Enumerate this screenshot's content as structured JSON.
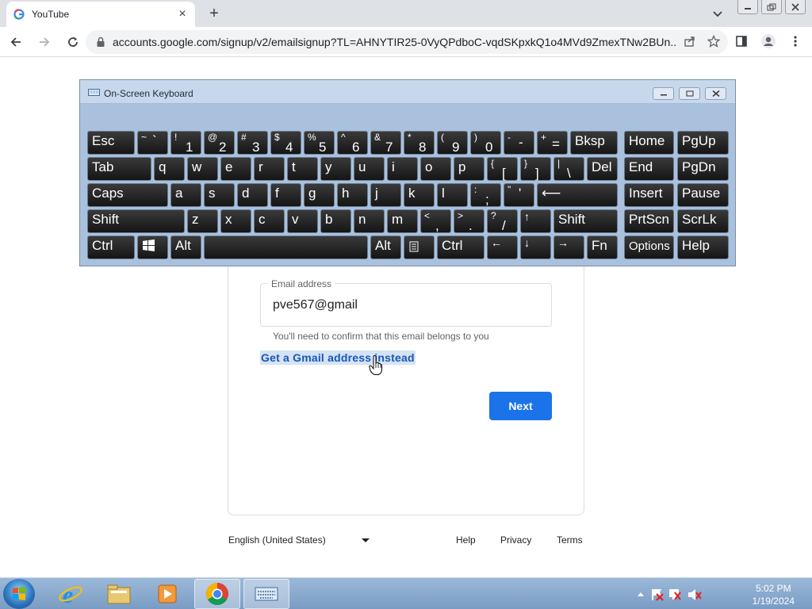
{
  "browser": {
    "tab_title": "YouTube",
    "url": "accounts.google.com/signup/v2/emailsignup?TL=AHNYTIR25-0VyQPdboC-vqdSKpxkQ1o4MVd9ZmexTNw2BUn..."
  },
  "form": {
    "email_label": "Email address",
    "email_value": "pve567@gmail",
    "helper": "You'll need to confirm that this email belongs to you",
    "gmail_link": "Get a Gmail address instead",
    "next": "Next"
  },
  "footer": {
    "language": "English (United States)",
    "help": "Help",
    "privacy": "Privacy",
    "terms": "Terms"
  },
  "osk": {
    "title": "On-Screen Keyboard",
    "keys": {
      "esc": "Esc",
      "tilde_top": "~",
      "tilde_bot": "`",
      "k1_top": "!",
      "k1": "1",
      "k2_top": "@",
      "k2": "2",
      "k3_top": "#",
      "k3": "3",
      "k4_top": "$",
      "k4": "4",
      "k5_top": "%",
      "k5": "5",
      "k6_top": "^",
      "k6": "6",
      "k7_top": "&",
      "k7": "7",
      "k8_top": "*",
      "k8": "8",
      "k9_top": "(",
      "k9": "9",
      "k0_top": ")",
      "k0": "0",
      "minus_top": "-",
      "minus": "-",
      "eq_top": "+",
      "eq": "=",
      "bksp": "Bksp",
      "home": "Home",
      "pgup": "PgUp",
      "tab": "Tab",
      "q": "q",
      "w": "w",
      "e": "e",
      "r": "r",
      "t": "t",
      "y": "y",
      "u": "u",
      "i": "i",
      "o": "o",
      "p": "p",
      "lbr_top": "{",
      "lbr": "[",
      "rbr_top": "}",
      "rbr": "]",
      "bs_top": "|",
      "bs": "\\",
      "del": "Del",
      "end": "End",
      "pgdn": "PgDn",
      "caps": "Caps",
      "a": "a",
      "s": "s",
      "d": "d",
      "f": "f",
      "g": "g",
      "h": "h",
      "j": "j",
      "k": "k",
      "l": "l",
      "semi_top": ":",
      "semi": ";",
      "quote_top": "\"",
      "quote": "'",
      "enter": "⟵",
      "insert": "Insert",
      "pause": "Pause",
      "shift": "Shift",
      "z": "z",
      "x": "x",
      "c": "c",
      "v": "v",
      "b": "b",
      "n": "n",
      "m": "m",
      "comma_top": "<",
      "comma": ",",
      "dot_top": ">",
      "dot": ".",
      "slash_top": "?",
      "slash": "/",
      "up": "↑",
      "shift_r": "Shift",
      "prtscn": "PrtScn",
      "scrlk": "ScrLk",
      "ctrl": "Ctrl",
      "alt": "Alt",
      "alt_r": "Alt",
      "ctrl_r": "Ctrl",
      "left": "←",
      "down": "↓",
      "right": "→",
      "fn": "Fn",
      "options": "Options",
      "help": "Help"
    }
  },
  "taskbar": {
    "time": "5:02 PM",
    "date": "1/19/2024"
  }
}
